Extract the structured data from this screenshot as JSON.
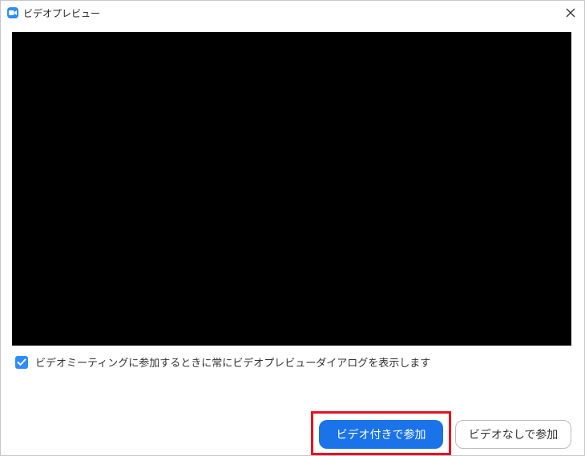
{
  "window": {
    "title": "ビデオプレビュー",
    "app_icon": "video-camera-icon",
    "close_icon": "close-icon"
  },
  "preview": {
    "background": "#000000"
  },
  "option": {
    "checked": true,
    "label": "ビデオミーティングに参加するときに常にビデオプレビューダイアログを表示します"
  },
  "buttons": {
    "join_with_video": "ビデオ付きで参加",
    "join_without_video": "ビデオなしで参加"
  },
  "colors": {
    "accent": "#1a73e8",
    "checkbox": "#2d8cff",
    "highlight": "#e81123"
  }
}
